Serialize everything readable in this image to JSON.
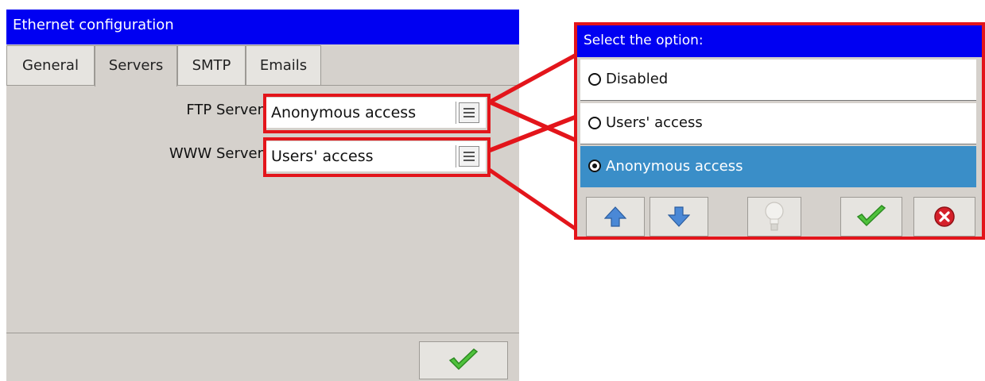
{
  "window": {
    "title": "Ethernet configuration",
    "tabs": [
      {
        "label": "General"
      },
      {
        "label": "Servers"
      },
      {
        "label": "SMTP"
      },
      {
        "label": "Emails"
      }
    ],
    "active_tab": "Servers",
    "fields": {
      "ftp": {
        "label": "FTP Server",
        "value": "Anonymous access"
      },
      "www": {
        "label": "WWW Server",
        "value": "Users' access"
      }
    },
    "ok_icon": "green-checkmark-icon"
  },
  "dialog": {
    "title": "Select the option:",
    "options": [
      {
        "label": "Disabled",
        "selected": false
      },
      {
        "label": "Users' access",
        "selected": false
      },
      {
        "label": "Anonymous access",
        "selected": true
      }
    ],
    "toolbar_icons": [
      "up-arrow-icon",
      "down-arrow-icon",
      "lightbulb-icon",
      "green-checkmark-icon",
      "red-close-icon"
    ]
  },
  "colors": {
    "title_bar": "#0000f2",
    "highlight": "#e3151b",
    "selected_row": "#3a8ec8",
    "panel": "#d5d1cc"
  }
}
